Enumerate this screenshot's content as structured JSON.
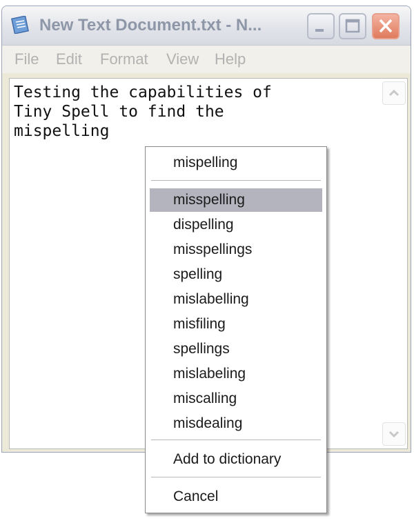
{
  "window": {
    "title": "New Text Document.txt - N...",
    "icon": "notepad-icon"
  },
  "titlebar_buttons": {
    "minimize_icon": "minimize-icon",
    "maximize_icon": "maximize-icon",
    "close_icon": "close-icon"
  },
  "menubar": {
    "items": [
      "File",
      "Edit",
      "Format",
      "View",
      "Help"
    ]
  },
  "editor": {
    "content": "Testing the capabilities of\nTiny Spell to find the\nmispelling"
  },
  "context_menu": {
    "original_word": "mispelling",
    "suggestions": [
      "misspelling",
      "dispelling",
      "misspellings",
      "spelling",
      "mislabelling",
      "misfiling",
      "spellings",
      "mislabeling",
      "miscalling",
      "misdealing"
    ],
    "selected_suggestion": "misspelling",
    "add_to_dictionary": "Add to dictionary",
    "cancel": "Cancel"
  }
}
